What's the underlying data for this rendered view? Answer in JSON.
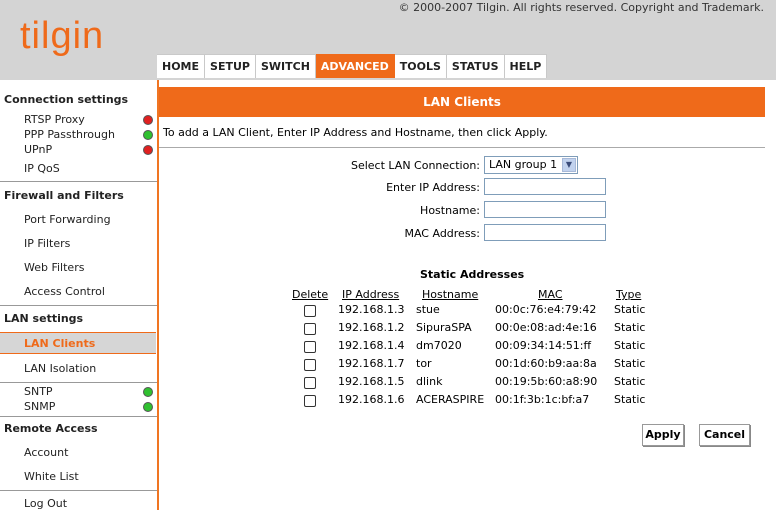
{
  "header": {
    "copyright": "© 2000-2007 Tilgin. All rights reserved. Copyright and Trademark.",
    "logo": "tilgin",
    "tabs": [
      {
        "label": "HOME"
      },
      {
        "label": "SETUP"
      },
      {
        "label": "SWITCH"
      },
      {
        "label": "ADVANCED",
        "active": true
      },
      {
        "label": "TOOLS"
      },
      {
        "label": "STATUS"
      },
      {
        "label": "HELP"
      }
    ]
  },
  "sidebar": {
    "connection_settings": {
      "title": "Connection settings",
      "items": [
        {
          "label": "RTSP Proxy",
          "status": "red"
        },
        {
          "label": "PPP Passthrough",
          "status": "green"
        },
        {
          "label": "UPnP",
          "status": "red"
        },
        {
          "label": "IP QoS"
        }
      ]
    },
    "firewall": {
      "title": "Firewall and Filters",
      "items": [
        {
          "label": "Port Forwarding"
        },
        {
          "label": "IP Filters"
        },
        {
          "label": "Web Filters"
        },
        {
          "label": "Access Control"
        }
      ]
    },
    "lan": {
      "title": "LAN settings",
      "items": [
        {
          "label": "LAN Clients",
          "active": true
        },
        {
          "label": "LAN Isolation"
        },
        {
          "label": "SNTP",
          "status": "green"
        },
        {
          "label": "SNMP",
          "status": "green"
        }
      ]
    },
    "remote": {
      "title": "Remote Access",
      "items": [
        {
          "label": "Account"
        },
        {
          "label": "White List"
        }
      ]
    },
    "logout": "Log Out"
  },
  "main": {
    "title": "LAN Clients",
    "intro": "To add a LAN Client, Enter IP Address and Hostname, then click Apply.",
    "form": {
      "select_label": "Select LAN Connection:",
      "select_value": "LAN group 1",
      "ip_label": "Enter IP Address:",
      "ip_value": "",
      "hostname_label": "Hostname:",
      "hostname_value": "",
      "mac_label": "MAC Address:",
      "mac_value": ""
    },
    "static": {
      "title": "Static Addresses",
      "headers": {
        "delete": "Delete",
        "ip": "IP Address",
        "hostname": "Hostname",
        "mac": "MAC",
        "type": "Type"
      },
      "rows": [
        {
          "ip": "192.168.1.3",
          "hostname": "stue",
          "mac": "00:0c:76:e4:79:42",
          "type": "Static"
        },
        {
          "ip": "192.168.1.2",
          "hostname": "SipuraSPA",
          "mac": "00:0e:08:ad:4e:16",
          "type": "Static"
        },
        {
          "ip": "192.168.1.4",
          "hostname": "dm7020",
          "mac": "00:09:34:14:51:ff",
          "type": "Static"
        },
        {
          "ip": "192.168.1.7",
          "hostname": "tor",
          "mac": "00:1d:60:b9:aa:8a",
          "type": "Static"
        },
        {
          "ip": "192.168.1.5",
          "hostname": "dlink",
          "mac": "00:19:5b:60:a8:90",
          "type": "Static"
        },
        {
          "ip": "192.168.1.6",
          "hostname": "ACERASPIRE",
          "mac": "00:1f:3b:1c:bf:a7",
          "type": "Static"
        }
      ]
    },
    "buttons": {
      "apply": "Apply",
      "cancel": "Cancel"
    }
  }
}
